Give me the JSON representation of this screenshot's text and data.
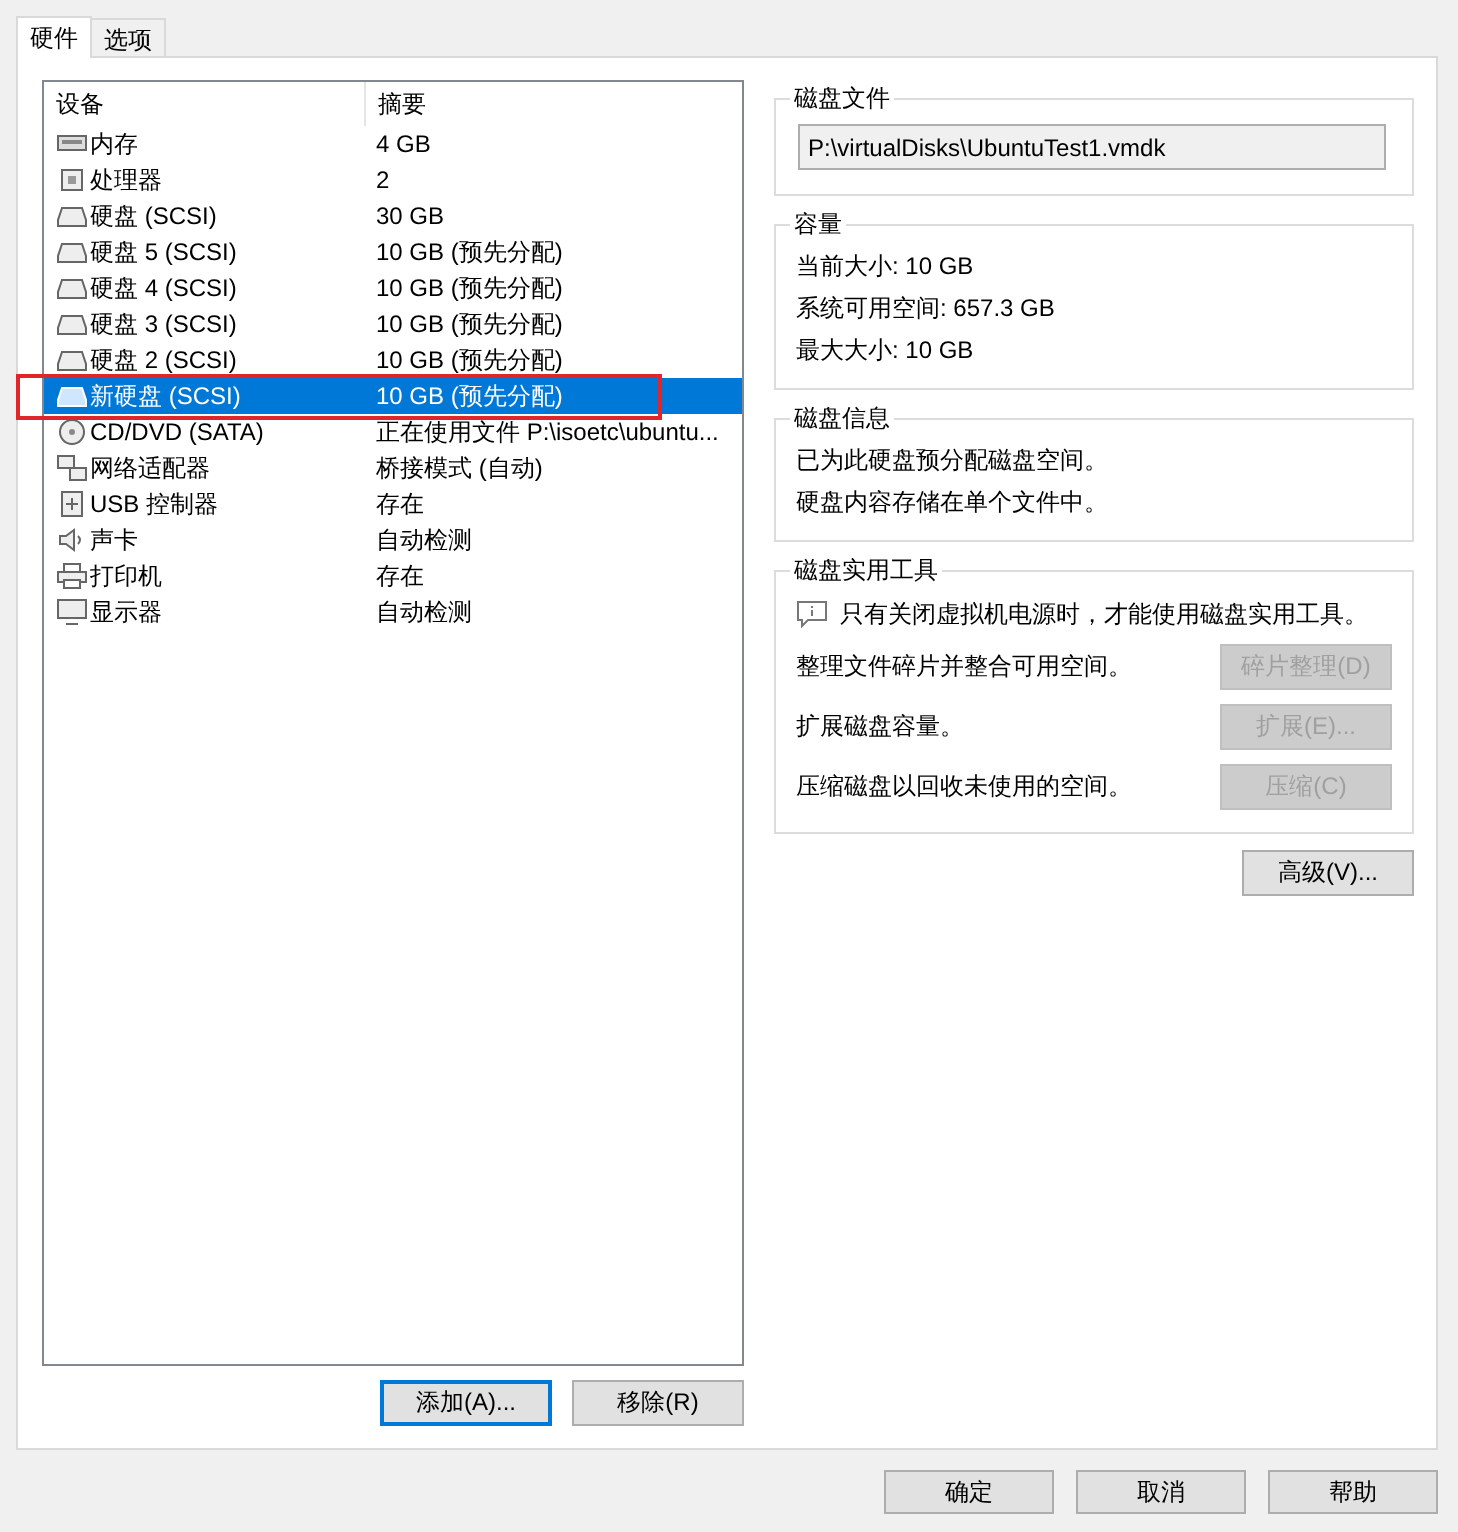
{
  "tabs": [
    {
      "label": "硬件",
      "selected": true
    },
    {
      "label": "选项",
      "selected": false
    }
  ],
  "device_list": {
    "columns": [
      "设备",
      "摘要"
    ],
    "rows": [
      {
        "kind": "memory",
        "device": "内存",
        "summary": "4 GB",
        "selected": false,
        "annotated": false
      },
      {
        "kind": "cpu",
        "device": "处理器",
        "summary": "2",
        "selected": false,
        "annotated": false
      },
      {
        "kind": "disk",
        "device": "硬盘 (SCSI)",
        "summary": "30 GB",
        "selected": false,
        "annotated": false
      },
      {
        "kind": "disk",
        "device": "硬盘 5 (SCSI)",
        "summary": "10 GB (预先分配)",
        "selected": false,
        "annotated": false
      },
      {
        "kind": "disk",
        "device": "硬盘 4 (SCSI)",
        "summary": "10 GB (预先分配)",
        "selected": false,
        "annotated": false
      },
      {
        "kind": "disk",
        "device": "硬盘 3 (SCSI)",
        "summary": "10 GB (预先分配)",
        "selected": false,
        "annotated": false
      },
      {
        "kind": "disk",
        "device": "硬盘 2 (SCSI)",
        "summary": "10 GB (预先分配)",
        "selected": false,
        "annotated": false
      },
      {
        "kind": "disk",
        "device": "新硬盘 (SCSI)",
        "summary": "10 GB (预先分配)",
        "selected": true,
        "annotated": true
      },
      {
        "kind": "cdrom",
        "device": "CD/DVD (SATA)",
        "summary": "正在使用文件 P:\\isoetc\\ubuntu...",
        "selected": false,
        "annotated": false
      },
      {
        "kind": "network",
        "device": "网络适配器",
        "summary": "桥接模式 (自动)",
        "selected": false,
        "annotated": false
      },
      {
        "kind": "usb",
        "device": "USB 控制器",
        "summary": "存在",
        "selected": false,
        "annotated": false
      },
      {
        "kind": "sound",
        "device": "声卡",
        "summary": "自动检测",
        "selected": false,
        "annotated": false
      },
      {
        "kind": "printer",
        "device": "打印机",
        "summary": "存在",
        "selected": false,
        "annotated": false
      },
      {
        "kind": "display",
        "device": "显示器",
        "summary": "自动检测",
        "selected": false,
        "annotated": false
      }
    ],
    "buttons": [
      {
        "label": "添加(A)...",
        "focused": true
      },
      {
        "label": "移除(R)",
        "focused": false
      }
    ]
  },
  "disk_file": {
    "title": "磁盘文件",
    "path": "P:\\virtualDisks\\UbuntuTest1.vmdk"
  },
  "capacity": {
    "title": "容量",
    "lines": [
      "当前大小: 10 GB",
      "系统可用空间: 657.3 GB",
      "最大大小: 10 GB"
    ]
  },
  "disk_info": {
    "title": "磁盘信息",
    "lines": [
      "已为此硬盘预分配磁盘空间。",
      "硬盘内容存储在单个文件中。"
    ]
  },
  "disk_utilities": {
    "title": "磁盘实用工具",
    "notice": "只有关闭虚拟机电源时，才能使用磁盘实用工具。",
    "actions": [
      {
        "description": "整理文件碎片并整合可用空间。",
        "button": "碎片整理(D)",
        "disabled": true
      },
      {
        "description": "扩展磁盘容量。",
        "button": "扩展(E)...",
        "disabled": true
      },
      {
        "description": "压缩磁盘以回收未使用的空间。",
        "button": "压缩(C)",
        "disabled": true
      }
    ]
  },
  "advanced_button": "高级(V)...",
  "dialog_buttons": [
    "确定",
    "取消",
    "帮助"
  ]
}
